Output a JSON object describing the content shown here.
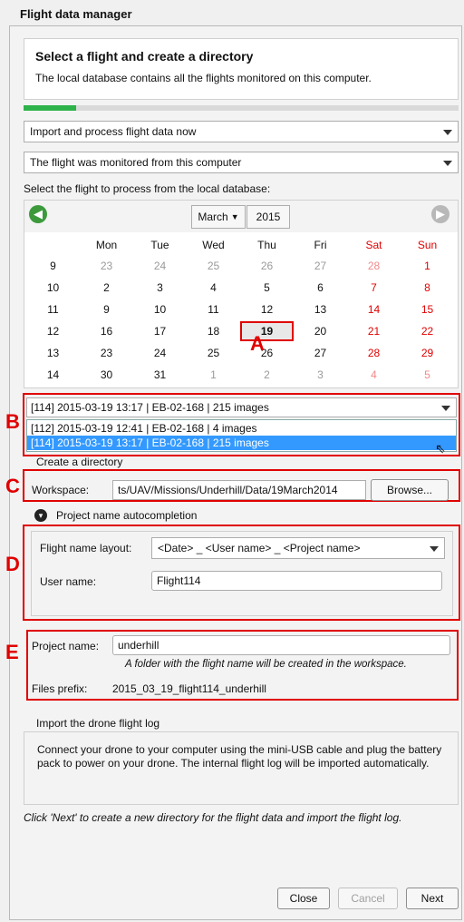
{
  "window": {
    "title": "Flight data manager"
  },
  "step": {
    "title": "Select a flight and create a directory",
    "subtitle": "The local database contains all the flights monitored on this computer.",
    "progress": 0.12
  },
  "mode_select": {
    "value": "Import and process flight data now"
  },
  "source_select": {
    "value": "The flight was monitored from this computer"
  },
  "flight_prompt": "Select the flight to process from the local database:",
  "calendar": {
    "month": "March",
    "year": "2015",
    "weekdays": [
      "Mon",
      "Tue",
      "Wed",
      "Thu",
      "Fri",
      "Sat",
      "Sun"
    ],
    "weeks": [
      {
        "wk": "9",
        "days": [
          "23",
          "24",
          "25",
          "26",
          "27",
          "28",
          "1"
        ],
        "muted": [
          1,
          1,
          1,
          1,
          1,
          1,
          0
        ]
      },
      {
        "wk": "10",
        "days": [
          "2",
          "3",
          "4",
          "5",
          "6",
          "7",
          "8"
        ],
        "muted": [
          0,
          0,
          0,
          0,
          0,
          0,
          0
        ]
      },
      {
        "wk": "11",
        "days": [
          "9",
          "10",
          "11",
          "12",
          "13",
          "14",
          "15"
        ],
        "muted": [
          0,
          0,
          0,
          0,
          0,
          0,
          0
        ]
      },
      {
        "wk": "12",
        "days": [
          "16",
          "17",
          "18",
          "19",
          "20",
          "21",
          "22"
        ],
        "muted": [
          0,
          0,
          0,
          0,
          0,
          0,
          0
        ]
      },
      {
        "wk": "13",
        "days": [
          "23",
          "24",
          "25",
          "26",
          "27",
          "28",
          "29"
        ],
        "muted": [
          0,
          0,
          0,
          0,
          0,
          0,
          0
        ]
      },
      {
        "wk": "14",
        "days": [
          "30",
          "31",
          "1",
          "2",
          "3",
          "4",
          "5"
        ],
        "muted": [
          0,
          0,
          1,
          1,
          1,
          1,
          1
        ]
      }
    ],
    "selected_day": "19"
  },
  "flight_select": {
    "value": "[114] 2015-03-19 13:17 | EB-02-168 | 215 images",
    "options": [
      "[112] 2015-03-19 12:41 | EB-02-168 | 4 images",
      "[114] 2015-03-19 13:17 | EB-02-168 | 215 images"
    ]
  },
  "directory": {
    "group_label": "Create a directory",
    "workspace_label": "Workspace:",
    "workspace_value": "ts/UAV/Missions/Underhill/Data/19March2014",
    "browse_label": "Browse..."
  },
  "autocomplete": {
    "toggle_label": "Project name autocompletion",
    "layout_label": "Flight name layout:",
    "layout_value": "<Date> _ <User name> _ <Project name>",
    "user_label": "User name:",
    "user_value": "Flight114"
  },
  "project": {
    "name_label": "Project name:",
    "name_value": "underhill",
    "hint": "A folder with the flight name will be created in the workspace.",
    "prefix_label": "Files prefix:",
    "prefix_value": "2015_03_19_flight114_underhill"
  },
  "flight_log": {
    "group_label": "Import the drone flight log",
    "text": "Connect your drone to your computer using the mini-USB cable and plug the battery pack to power on your drone. The internal flight log will be imported automatically."
  },
  "footer_note": "Click 'Next' to create a new directory for the flight data and import the flight log.",
  "buttons": {
    "close": "Close",
    "cancel": "Cancel",
    "next": "Next"
  },
  "callouts": {
    "a": "A",
    "b": "B",
    "c": "C",
    "d": "D",
    "e": "E"
  },
  "colors": {
    "accent_red": "#e00000",
    "progress_green": "#2db34a",
    "selection_blue": "#3399ff"
  }
}
